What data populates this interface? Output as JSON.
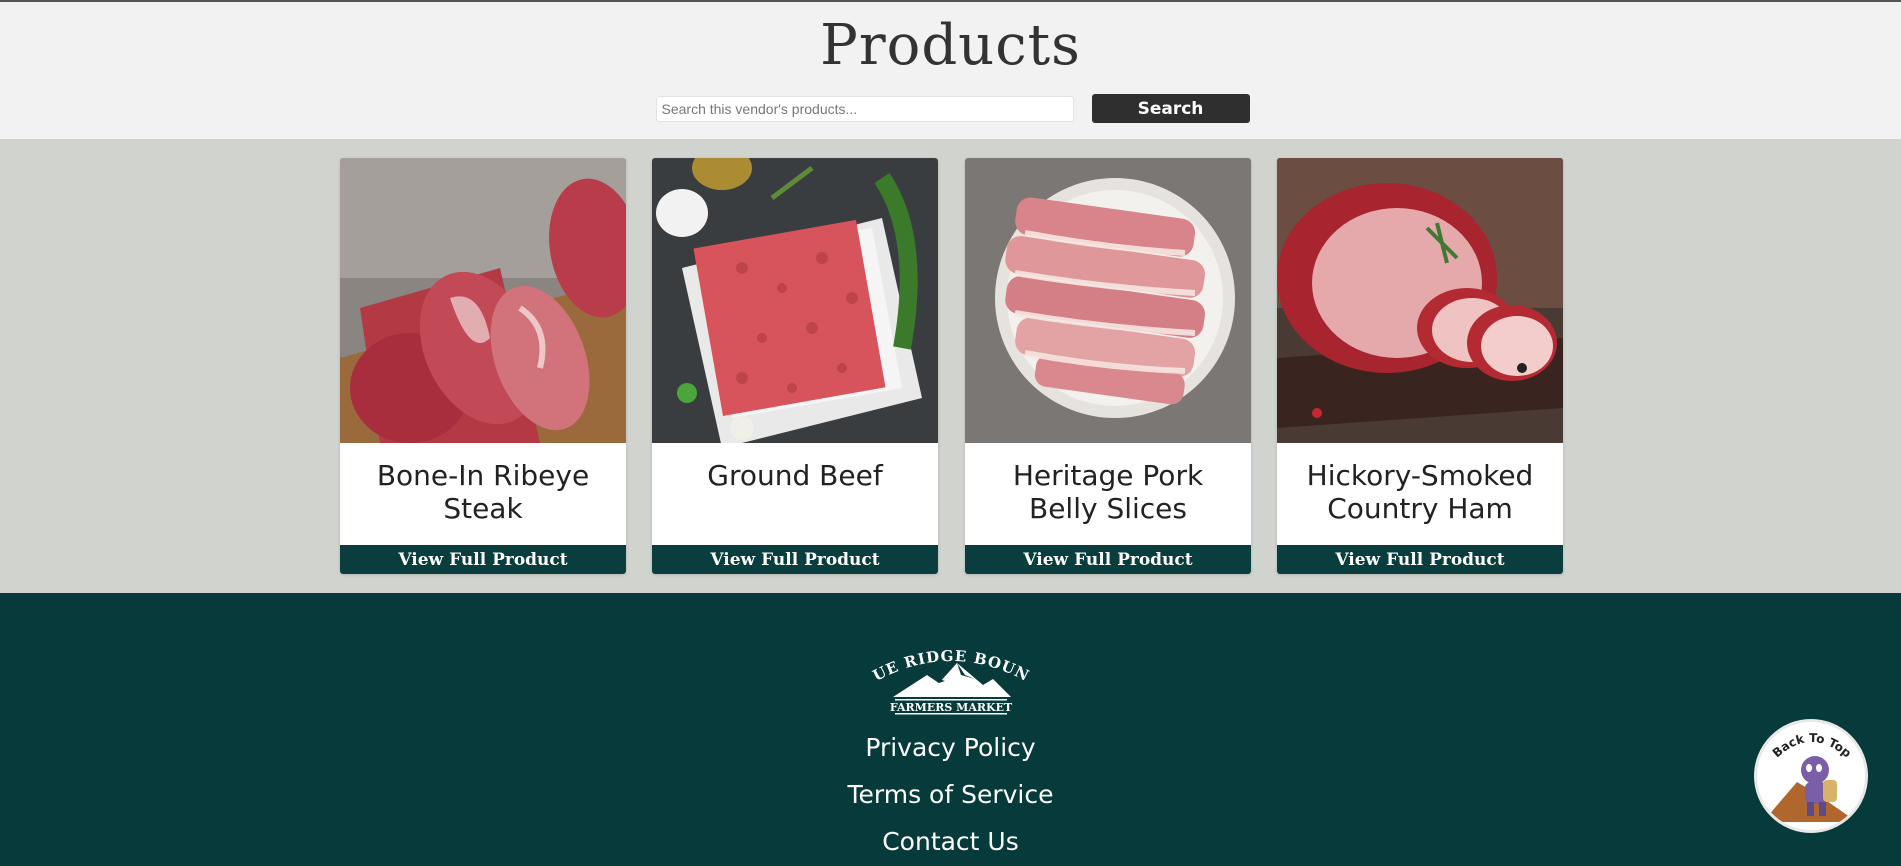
{
  "header": {
    "title": "Products",
    "search": {
      "placeholder": "Search this vendor's products...",
      "button_label": "Search"
    }
  },
  "products": [
    {
      "name": "Bone-In Ribeye Steak",
      "button_label": "View Full Product"
    },
    {
      "name": "Ground Beef",
      "button_label": "View Full Product"
    },
    {
      "name": "Heritage Pork Belly Slices",
      "button_label": "View Full Product"
    },
    {
      "name": "Hickory-Smoked Country Ham",
      "button_label": "View Full Product"
    }
  ],
  "footer": {
    "logo": {
      "line1": "BLUE RIDGE BOUNTY",
      "line2": "FARMERS MARKET"
    },
    "links": [
      "Privacy Policy",
      "Terms of Service",
      "Contact Us"
    ]
  },
  "back_to_top": {
    "label": "Back To Top"
  },
  "colors": {
    "header_bg": "#f2f2f2",
    "band_bg": "#d1d4ce",
    "footer_bg": "#073a3a",
    "card_button": "#0a3d3d",
    "search_button": "#2f2f2f"
  }
}
